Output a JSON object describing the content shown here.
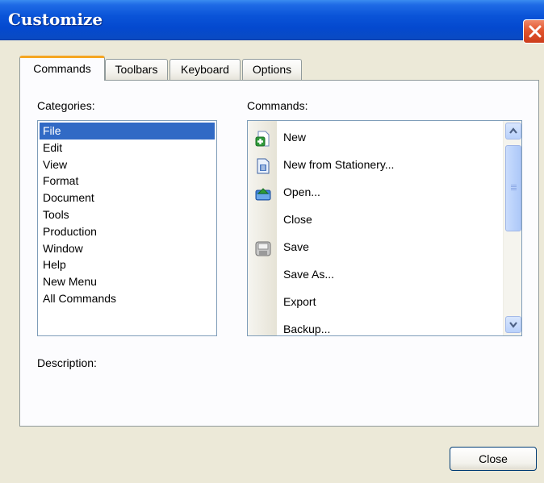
{
  "window": {
    "title": "Customize"
  },
  "tabs": [
    {
      "label": "Commands",
      "active": true
    },
    {
      "label": "Toolbars",
      "active": false
    },
    {
      "label": "Keyboard",
      "active": false
    },
    {
      "label": "Options",
      "active": false
    }
  ],
  "categories": {
    "label": "Categories:",
    "items": [
      "File",
      "Edit",
      "View",
      "Format",
      "Document",
      "Tools",
      "Production",
      "Window",
      "Help",
      "New Menu",
      "All Commands"
    ],
    "selected": "File"
  },
  "commands": {
    "label": "Commands:",
    "items": [
      {
        "label": "New",
        "icon": "new-document-icon"
      },
      {
        "label": "New from Stationery...",
        "icon": "stationery-icon"
      },
      {
        "label": "Open...",
        "icon": "open-folder-icon"
      },
      {
        "label": "Close",
        "icon": ""
      },
      {
        "label": "Save",
        "icon": "save-disk-icon"
      },
      {
        "label": "Save As...",
        "icon": ""
      },
      {
        "label": "Export",
        "icon": ""
      },
      {
        "label": "Backup...",
        "icon": ""
      }
    ]
  },
  "description": {
    "label": "Description:"
  },
  "buttons": {
    "close_label": "Close"
  },
  "colors": {
    "title_bar": "#0a54d8",
    "selection": "#316ac5",
    "active_tab_accent": "#f5a623"
  }
}
